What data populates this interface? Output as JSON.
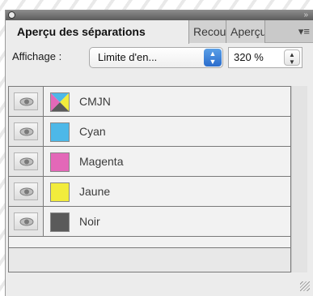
{
  "panel": {
    "tabs": [
      {
        "label": "Aperçu des séparations",
        "active": true
      },
      {
        "label": "Recouvrement",
        "active": false
      },
      {
        "label": "Aperçu",
        "active": false
      }
    ],
    "collapse_glyph": "»",
    "menu_glyph": "▾≡"
  },
  "controls": {
    "affichage_label": "Affichage :",
    "affichage_value": "Limite d'en...",
    "zoom_value": "320 %"
  },
  "separations": [
    {
      "label": "CMJN",
      "color": "#000000",
      "icon": "eye-icon",
      "visible": true
    },
    {
      "label": "Cyan",
      "color": "#4db8e8",
      "icon": "eye-icon",
      "visible": true
    },
    {
      "label": "Magenta",
      "color": "#e368b8",
      "icon": "eye-icon",
      "visible": true
    },
    {
      "label": "Jaune",
      "color": "#f2ec3c",
      "icon": "eye-icon",
      "visible": true
    },
    {
      "label": "Noir",
      "color": "#5a5a5a",
      "icon": "eye-icon",
      "visible": true
    }
  ],
  "colors": {
    "accent": "#2a6ccc",
    "cyan": "#4db8e8",
    "magenta": "#e368b8",
    "yellow": "#f2ec3c",
    "black": "#5a5a5a"
  }
}
